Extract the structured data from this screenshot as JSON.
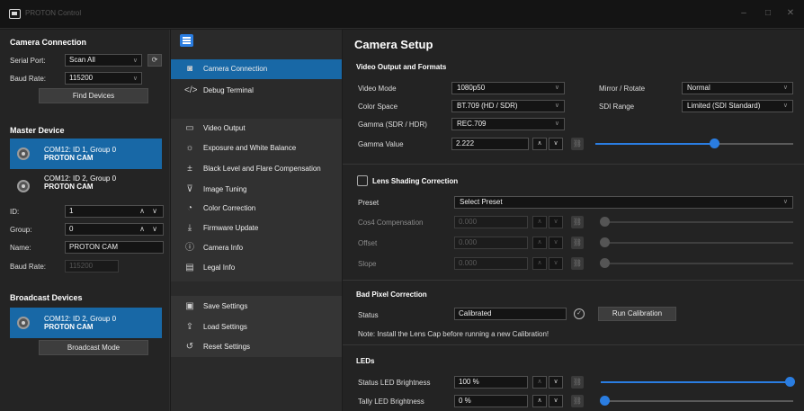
{
  "window": {
    "title": "PROTON Control",
    "minimize": "–",
    "maximize": "□",
    "close": "✕"
  },
  "connection": {
    "title": "Camera Connection",
    "serial_label": "Serial Port:",
    "serial_value": "Scan All",
    "baud_label": "Baud Rate:",
    "baud_value": "115200",
    "refresh_icon": "refresh-icon",
    "find_button": "Find Devices"
  },
  "master": {
    "title": "Master Device",
    "devices": [
      {
        "line1": "COM12: ID 1, Group 0",
        "line2": "PROTON CAM",
        "selected": true
      },
      {
        "line1": "COM12: ID 2, Group 0",
        "line2": "PROTON CAM",
        "selected": false
      }
    ],
    "id_label": "ID:",
    "id_value": "1",
    "group_label": "Group:",
    "group_value": "0",
    "name_label": "Name:",
    "name_value": "PROTON CAM",
    "baud_label": "Baud Rate:",
    "baud_value": "115200"
  },
  "broadcast": {
    "title": "Broadcast Devices",
    "devices": [
      {
        "line1": "COM12: ID 2, Group 0",
        "line2": "PROTON CAM"
      }
    ],
    "mode_button": "Broadcast Mode"
  },
  "nav": {
    "group1": [
      {
        "label": "Camera Connection",
        "icon": "camera-icon",
        "selected": true
      },
      {
        "label": "Debug Terminal",
        "icon": "code-icon",
        "selected": false
      }
    ],
    "group2": [
      {
        "label": "Video Output",
        "icon": "video-icon",
        "selected": false
      },
      {
        "label": "Exposure and White Balance",
        "icon": "sun-icon",
        "selected": false
      },
      {
        "label": "Black Level and Flare Compensation",
        "icon": "levels-icon",
        "selected": false
      },
      {
        "label": "Image Tuning",
        "icon": "tune-icon",
        "selected": false
      },
      {
        "label": "Color Correction",
        "icon": "palette-icon",
        "selected": false
      },
      {
        "label": "Firmware Update",
        "icon": "download-icon",
        "selected": false
      },
      {
        "label": "Camera Info",
        "icon": "info-icon",
        "selected": false
      },
      {
        "label": "Legal Info",
        "icon": "document-icon",
        "selected": false
      }
    ],
    "group3": [
      {
        "label": "Save Settings",
        "icon": "save-icon"
      },
      {
        "label": "Load Settings",
        "icon": "upload-icon"
      },
      {
        "label": "Reset Settings",
        "icon": "reset-icon"
      }
    ]
  },
  "main": {
    "title": "Camera Setup",
    "video": {
      "title": "Video Output and Formats",
      "video_mode_label": "Video Mode",
      "video_mode_value": "1080p50",
      "color_space_label": "Color Space",
      "color_space_value": "BT.709 (HD / SDR)",
      "gamma_label": "Gamma (SDR / HDR)",
      "gamma_value": "REC.709",
      "gamma_val_label": "Gamma Value",
      "gamma_val_value": "2.222",
      "gamma_slider_pct": 0.6,
      "mirror_label": "Mirror / Rotate",
      "mirror_value": "Normal",
      "sdi_label": "SDI Range",
      "sdi_value": "Limited (SDI Standard)"
    },
    "lens": {
      "title": "Lens Shading Correction",
      "preset_label": "Preset",
      "preset_value": "Select Preset",
      "cos4_label": "Cos4 Compensation",
      "cos4_value": "0.000",
      "offset_label": "Offset",
      "offset_value": "0.000",
      "slope_label": "Slope",
      "slope_value": "0.000"
    },
    "badpixel": {
      "title": "Bad Pixel Correction",
      "status_label": "Status",
      "status_value": "Calibrated",
      "run_button": "Run Calibration",
      "note": "Note: Install the Lens Cap before running a new Calibration!"
    },
    "leds": {
      "title": "LEDs",
      "status_label": "Status LED Brightness",
      "status_value": "100 %",
      "status_pct": 1.0,
      "tally_label": "Tally LED Brightness",
      "tally_value": "0 %",
      "tally_pct": 0.0
    }
  }
}
